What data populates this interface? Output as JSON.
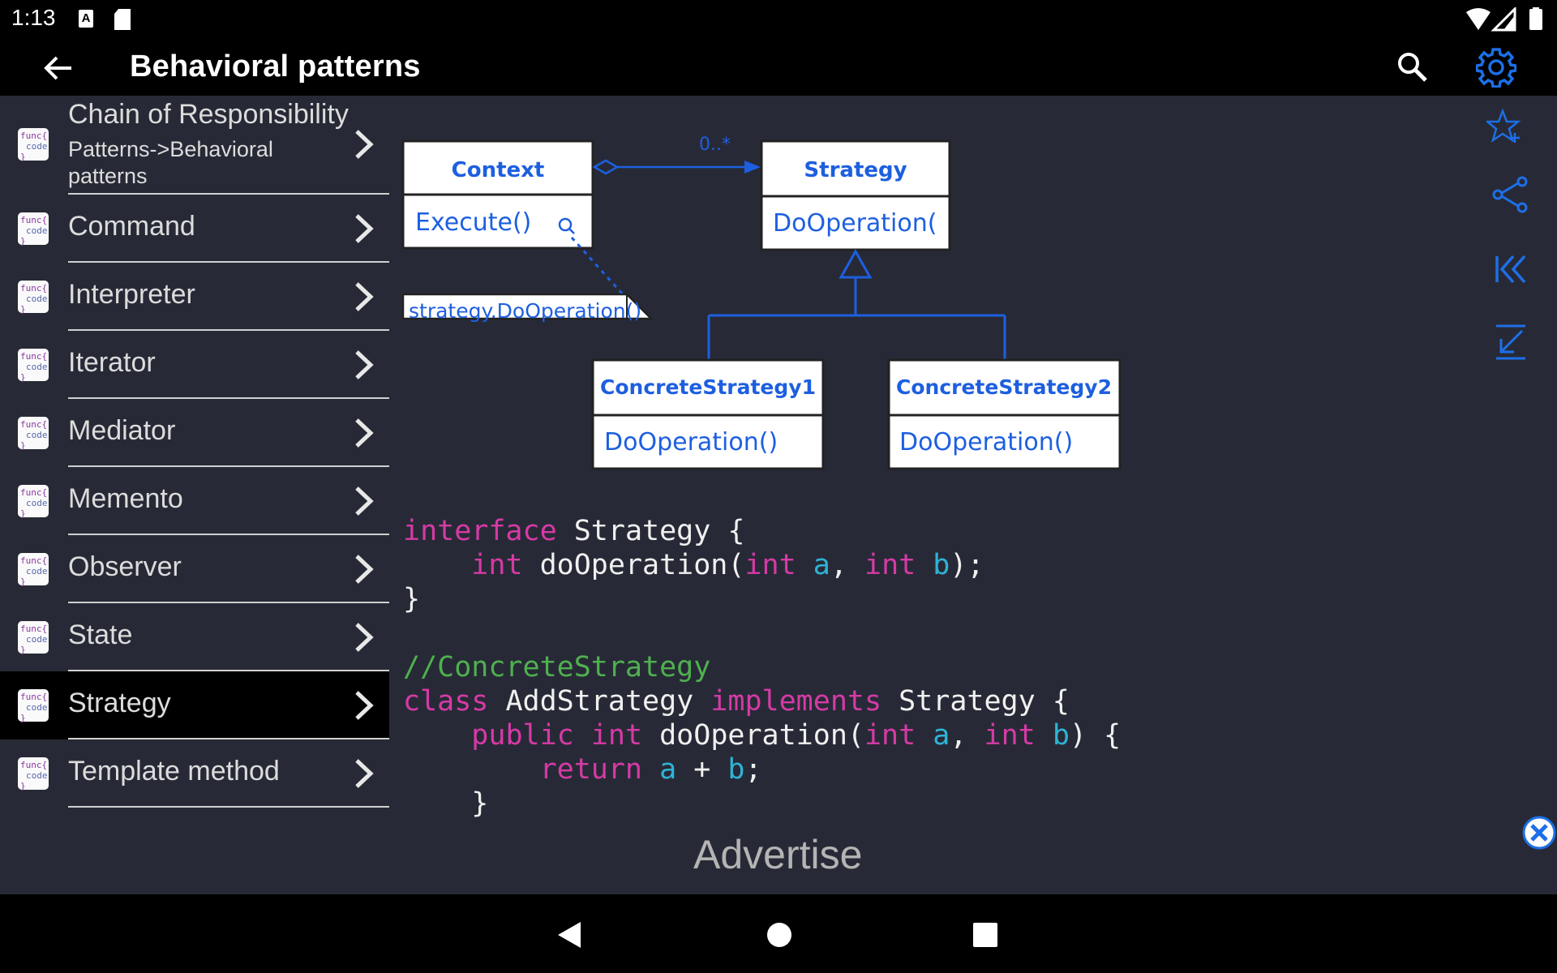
{
  "status": {
    "time": "1:13",
    "a_badge": "A"
  },
  "appbar": {
    "title": "Behavioral patterns"
  },
  "sidebar": {
    "icon_text": [
      "func{",
      "code",
      "}"
    ],
    "items": [
      {
        "label": "Chain of Responsibility",
        "sub": "Patterns->Behavioral patterns"
      },
      {
        "label": "Command"
      },
      {
        "label": "Interpreter"
      },
      {
        "label": "Iterator"
      },
      {
        "label": "Mediator"
      },
      {
        "label": "Memento"
      },
      {
        "label": "Observer"
      },
      {
        "label": "State"
      },
      {
        "label": "Strategy"
      },
      {
        "label": "Template method"
      }
    ],
    "selected": "Strategy"
  },
  "diagram": {
    "context_title": "Context",
    "context_method": "Execute()",
    "multiplicity": "0..*",
    "strategy_title": "Strategy",
    "strategy_method": "DoOperation(",
    "note": "strategy.DoOperation()",
    "cs1_title": "ConcreteStrategy1",
    "cs1_method": "DoOperation()",
    "cs2_title": "ConcreteStrategy2",
    "cs2_method": "DoOperation()"
  },
  "code": {
    "kw_interface": "interface",
    "name_strategy": "Strategy",
    "int": "int",
    "method": "doOperation",
    "a": "a",
    "b": "b",
    "comment": "//ConcreteStrategy",
    "kw_class": "class",
    "name_add": "AddStrategy",
    "kw_implements": "implements",
    "kw_public": "public",
    "kw_return": "return"
  },
  "ad": {
    "label": "Advertise"
  },
  "colors": {
    "background": "#272a36",
    "bar": "#000000",
    "accent_blue": "#1d5fe0",
    "keyword": "#d63aa6",
    "variable": "#2fb3d6",
    "comment": "#4fb04f"
  }
}
